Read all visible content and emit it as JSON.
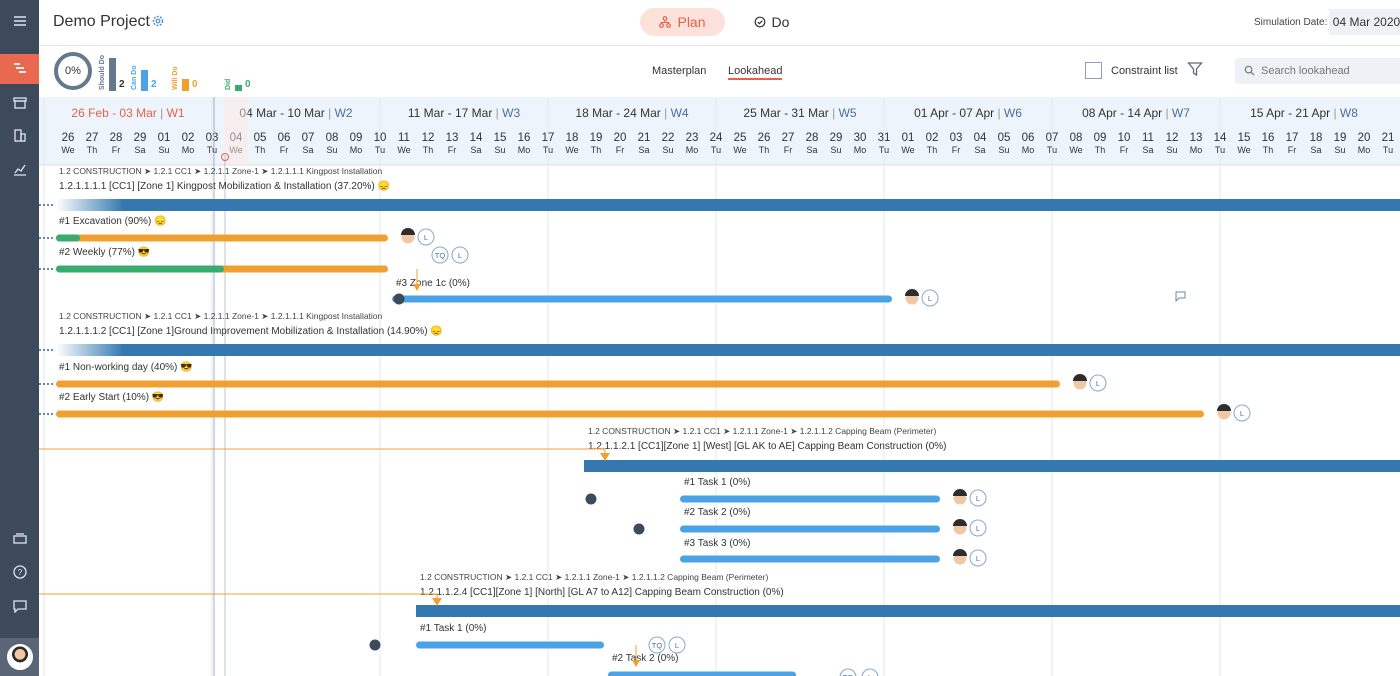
{
  "project": {
    "title": "Demo Project"
  },
  "tabs": {
    "plan": "Plan",
    "do": "Do"
  },
  "simulation": {
    "label": "Simulation Date:",
    "date": "04 Mar 2020"
  },
  "stats": {
    "progress": "0%",
    "items": [
      {
        "label": "Should Do",
        "count": "2",
        "color": "#64798c"
      },
      {
        "label": "Can Do",
        "count": "2",
        "color": "#4aa3e6"
      },
      {
        "label": "Will Do",
        "count": "0",
        "color": "#f0a030"
      },
      {
        "label": "Did",
        "count": "0",
        "color": "#3aab6e"
      }
    ]
  },
  "views": {
    "masterplan": "Masterplan",
    "lookahead": "Lookahead"
  },
  "constraint": {
    "label": "Constraint list"
  },
  "search": {
    "placeholder": "Search lookahead"
  },
  "colors": {
    "sidebar": "#3d4a5c",
    "accent": "#e8604a",
    "bar_dark": "#3578b0",
    "bar_blue": "#4aa3e6",
    "bar_orange": "#f0a030",
    "bar_green": "#3aab6e"
  },
  "timeline": {
    "start": "26 Feb 2020",
    "today": "04 Mar 2020",
    "weeks": [
      {
        "range": "26 Feb - 03 Mar",
        "week": "W1"
      },
      {
        "range": "04 Mar - 10 Mar",
        "week": "W2"
      },
      {
        "range": "11 Mar - 17 Mar",
        "week": "W3"
      },
      {
        "range": "18 Mar - 24 Mar",
        "week": "W4"
      },
      {
        "range": "25 Mar - 31 Mar",
        "week": "W5"
      },
      {
        "range": "01 Apr - 07 Apr",
        "week": "W6"
      },
      {
        "range": "08 Apr - 14 Apr",
        "week": "W7"
      },
      {
        "range": "15 Apr - 21 Apr",
        "week": "W8"
      }
    ],
    "days": [
      "26",
      "27",
      "28",
      "29",
      "01",
      "02",
      "03",
      "04",
      "05",
      "06",
      "07",
      "08",
      "09",
      "10",
      "11",
      "12",
      "13",
      "14",
      "15",
      "16",
      "17",
      "18",
      "19",
      "20",
      "21",
      "22",
      "23",
      "24",
      "25",
      "26",
      "27",
      "28",
      "29",
      "30",
      "31",
      "01",
      "02",
      "03",
      "04",
      "05",
      "06",
      "07",
      "08",
      "09",
      "10",
      "11",
      "12",
      "13",
      "14",
      "15",
      "16",
      "17",
      "18",
      "19",
      "20",
      "21"
    ],
    "dows": [
      "We",
      "Th",
      "Fr",
      "Sa",
      "Su",
      "Mo",
      "Tu"
    ]
  },
  "tasks": [
    {
      "crumb": "1.2 CONSTRUCTION ➤ 1.2.1 CC1 ➤ 1.2.1.1 Zone-1 ➤ 1.2.1.1.1 Kingpost Installation",
      "kind": "parent",
      "label": "1.2.1.1.1.1 [CC1] [Zone 1] Kingpost Mobilization & Installation (37.20%) 😞",
      "start": "26 Feb",
      "end": "21 Apr"
    },
    {
      "kind": "task",
      "label": "#1 Excavation (90%) 😞",
      "start": "26 Feb",
      "end": "10 Mar",
      "tags": [
        "L"
      ]
    },
    {
      "kind": "task",
      "label": "#2 Weekly (77%) 😎",
      "start": "26 Feb",
      "end": "10 Mar",
      "tags": [
        "TQ",
        "L"
      ]
    },
    {
      "kind": "task",
      "label": "#3 Zone 1c (0%)",
      "start": "11 Mar",
      "end": "31 Mar",
      "tags": [
        "L"
      ]
    },
    {
      "crumb": "1.2 CONSTRUCTION ➤ 1.2.1 CC1 ➤ 1.2.1.1 Zone-1 ➤ 1.2.1.1.1 Kingpost Installation",
      "kind": "parent",
      "label": "1.2.1.1.1.2 [CC1] [Zone 1]Ground Improvement Mobilization & Installation (14.90%) 😞",
      "start": "26 Feb",
      "end": "21 Apr"
    },
    {
      "kind": "task",
      "label": "#1 Non-working day (40%) 😎",
      "start": "26 Feb",
      "end": "07 Apr",
      "tags": [
        "L"
      ]
    },
    {
      "kind": "task",
      "label": "#2 Early Start (10%) 😎",
      "start": "26 Feb",
      "end": "13 Apr",
      "tags": [
        "L"
      ]
    },
    {
      "crumb": "1.2 CONSTRUCTION ➤ 1.2.1 CC1 ➤ 1.2.1.1 Zone-1 ➤ 1.2.1.1.2 Capping Beam (Perimeter)",
      "kind": "parent",
      "label": "1.2.1.1.2.1 [CC1][Zone 1] [West] [GL AK to AE] Capping Beam Construction (0%)",
      "start": "19 Mar",
      "end": "21 Apr"
    },
    {
      "kind": "task",
      "label": "#1 Task 1 (0%)",
      "start": "23 Mar",
      "end": "02 Apr",
      "tags": [
        "L"
      ]
    },
    {
      "kind": "task",
      "label": "#2 Task 2 (0%)",
      "start": "23 Mar",
      "end": "02 Apr",
      "tags": [
        "L"
      ]
    },
    {
      "kind": "task",
      "label": "#3 Task 3 (0%)",
      "start": "23 Mar",
      "end": "02 Apr",
      "tags": [
        "L"
      ]
    },
    {
      "crumb": "1.2 CONSTRUCTION ➤ 1.2.1 CC1 ➤ 1.2.1.1 Zone-1 ➤ 1.2.1.1.2 Capping Beam (Perimeter)",
      "kind": "parent",
      "label": "1.2.1.1.2.4 [CC1][Zone 1] [North] [GL A7 to A12] Capping Beam Construction (0%)",
      "start": "12 Mar",
      "end": "21 Apr"
    },
    {
      "kind": "task",
      "label": "#1 Task 1 (0%)",
      "start": "12 Mar",
      "end": "19 Mar",
      "tags": [
        "TQ",
        "L"
      ]
    },
    {
      "kind": "task",
      "label": "#2 Task 2 (0%)",
      "start": "20 Mar",
      "end": "27 Mar",
      "tags": [
        "TQ",
        "L"
      ]
    }
  ]
}
